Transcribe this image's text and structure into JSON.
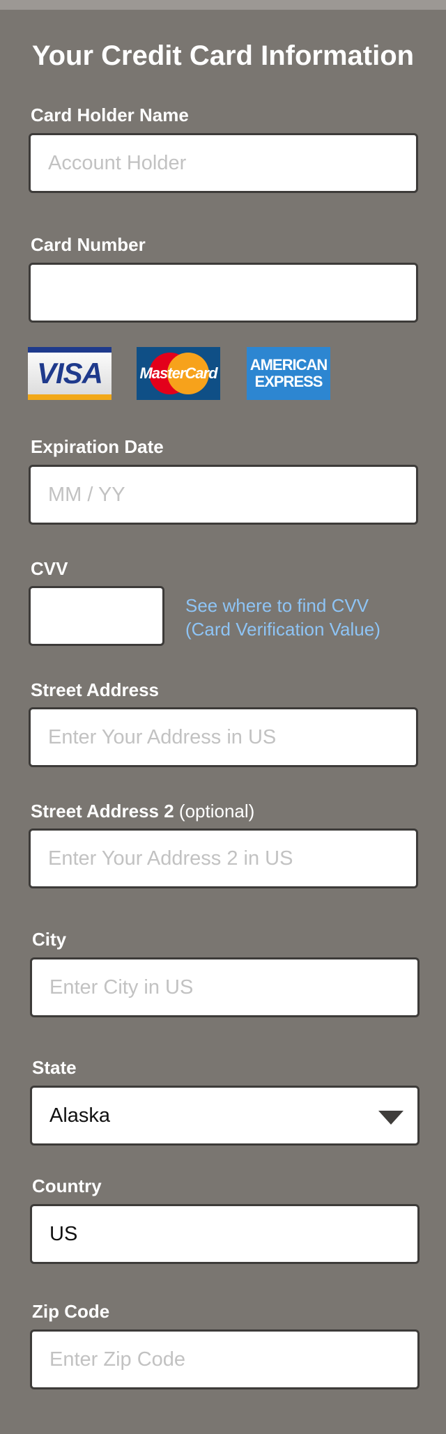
{
  "title": "Your Credit Card Information",
  "cardHolder": {
    "label": "Card Holder Name",
    "placeholder": "Account Holder",
    "value": ""
  },
  "cardNumber": {
    "label": "Card Number",
    "placeholder": "",
    "value": ""
  },
  "cards": {
    "visa": {
      "text": "VISA",
      "icon": "visa-logo"
    },
    "mastercard": {
      "text": "MasterCard",
      "icon": "mastercard-logo"
    },
    "amex": {
      "line1": "AMERICAN",
      "line2": "EXPRESS",
      "icon": "american-express-logo"
    }
  },
  "expiration": {
    "label": "Expiration Date",
    "placeholder": "MM / YY",
    "value": ""
  },
  "cvv": {
    "label": "CVV",
    "placeholder": "",
    "value": "",
    "link_line1": "See where to find CVV",
    "link_line2": "(Card Verification Value)"
  },
  "street": {
    "label": "Street Address",
    "placeholder": "Enter Your Address in US",
    "value": ""
  },
  "street2": {
    "label": "Street Address 2",
    "optional": "(optional)",
    "placeholder": "Enter Your Address 2 in US",
    "value": ""
  },
  "city": {
    "label": "City",
    "placeholder": "Enter City in US",
    "value": ""
  },
  "state": {
    "label": "State",
    "value": "Alaska",
    "icon": "dropdown-arrow-icon"
  },
  "country": {
    "label": "Country",
    "placeholder": "",
    "value": "US"
  },
  "zip": {
    "label": "Zip Code",
    "placeholder": "Enter Zip Code",
    "value": ""
  },
  "colors": {
    "background": "#7a7671",
    "link": "#8ec4f5",
    "border": "#3d3b39"
  }
}
